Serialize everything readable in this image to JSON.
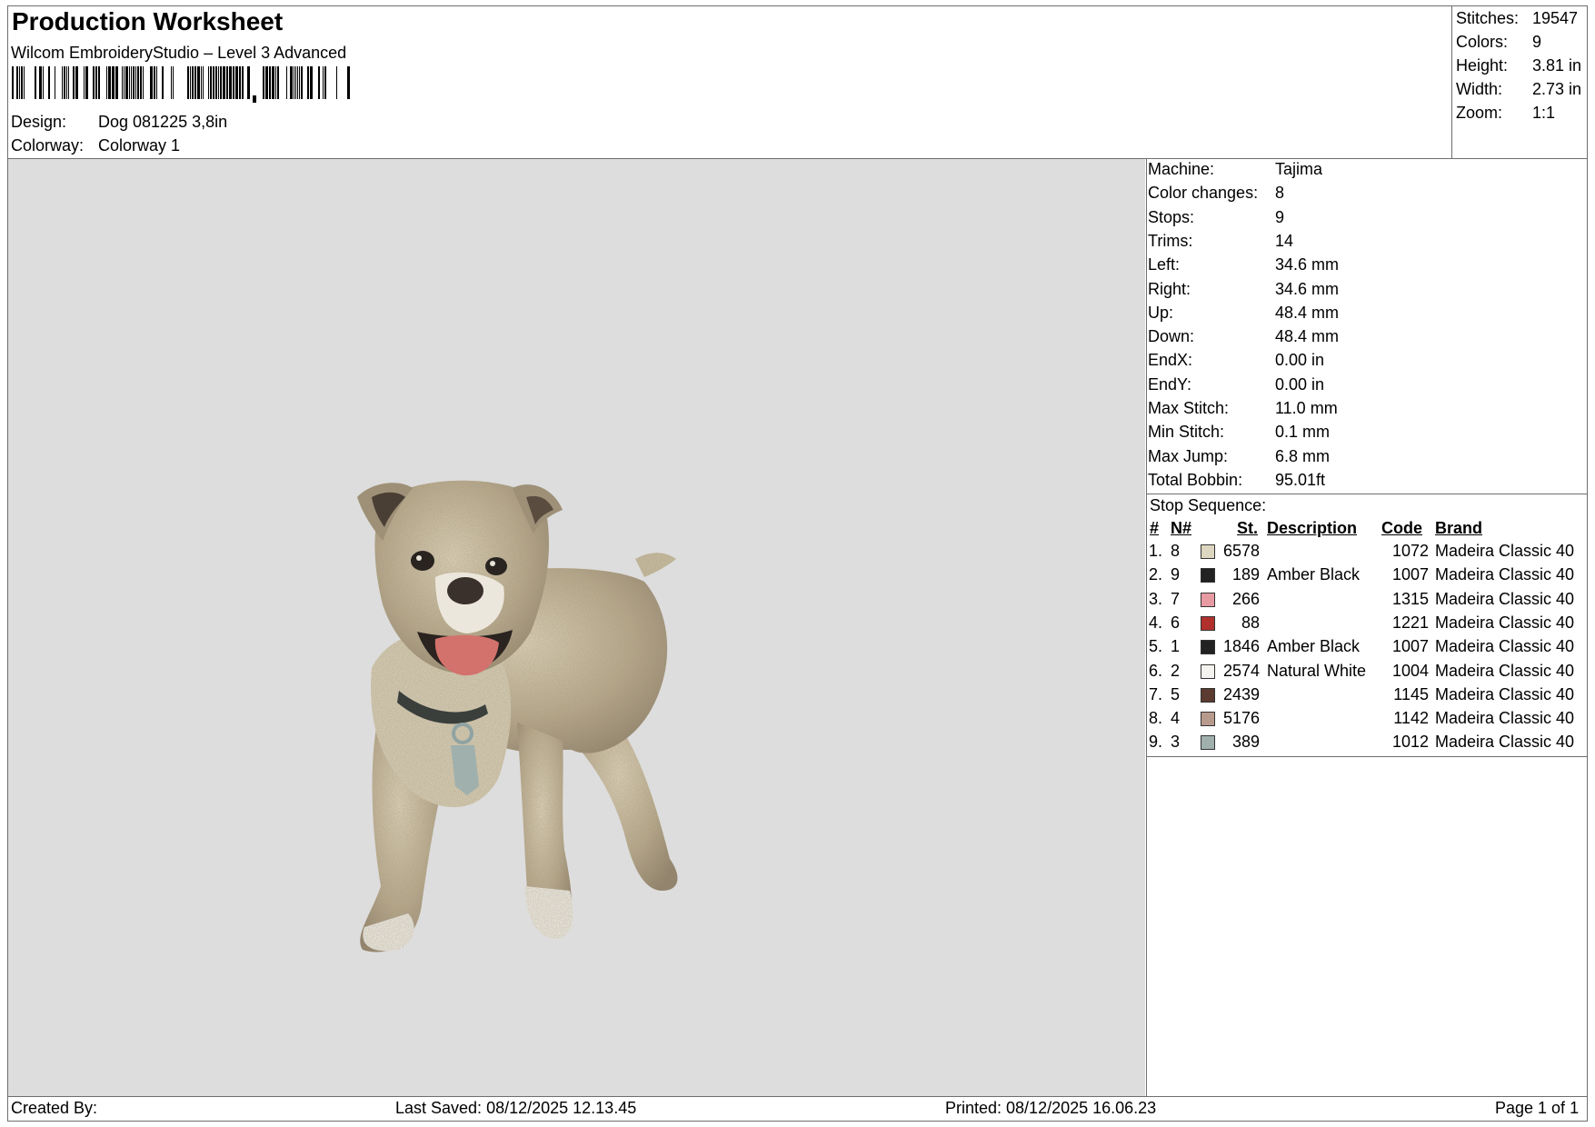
{
  "header": {
    "title": "Production Worksheet",
    "subtitle": "Wilcom EmbroideryStudio – Level 3 Advanced",
    "design_label": "Design:",
    "design_value": "Dog 081225 3,8in",
    "colorway_label": "Colorway:",
    "colorway_value": "Colorway 1"
  },
  "stats": [
    {
      "label": "Stitches:",
      "value": "19547"
    },
    {
      "label": "Colors:",
      "value": "9"
    },
    {
      "label": "Height:",
      "value": "3.81 in"
    },
    {
      "label": "Width:",
      "value": "2.73 in"
    },
    {
      "label": "Zoom:",
      "value": "1:1"
    }
  ],
  "machine_info": [
    {
      "label": "Machine:",
      "value": "Tajima"
    },
    {
      "label": "Color changes:",
      "value": "8"
    },
    {
      "label": "Stops:",
      "value": "9"
    },
    {
      "label": "Trims:",
      "value": "14"
    },
    {
      "label": "Left:",
      "value": "34.6 mm"
    },
    {
      "label": "Right:",
      "value": "34.6 mm"
    },
    {
      "label": "Up:",
      "value": "48.4 mm"
    },
    {
      "label": "Down:",
      "value": "48.4 mm"
    },
    {
      "label": "EndX:",
      "value": "0.00 in"
    },
    {
      "label": "EndY:",
      "value": "0.00 in"
    },
    {
      "label": "Max Stitch:",
      "value": "11.0 mm"
    },
    {
      "label": "Min Stitch:",
      "value": "0.1 mm"
    },
    {
      "label": "Max Jump:",
      "value": "6.8 mm"
    },
    {
      "label": "Total Bobbin:",
      "value": "95.01ft"
    }
  ],
  "stop_sequence": {
    "title": "Stop Sequence:",
    "headers": {
      "idx": "#",
      "n": "N#",
      "st": "St.",
      "desc": "Description",
      "code": "Code",
      "brand": "Brand"
    },
    "rows": [
      {
        "idx": "1.",
        "n": "8",
        "color": "#ddd6c0",
        "st": "6578",
        "desc": "",
        "code": "1072",
        "brand": "Madeira Classic 40"
      },
      {
        "idx": "2.",
        "n": "9",
        "color": "#222222",
        "st": "189",
        "desc": "Amber Black",
        "code": "1007",
        "brand": "Madeira Classic 40"
      },
      {
        "idx": "3.",
        "n": "7",
        "color": "#e89aa2",
        "st": "266",
        "desc": "",
        "code": "1315",
        "brand": "Madeira Classic 40"
      },
      {
        "idx": "4.",
        "n": "6",
        "color": "#b2302c",
        "st": "88",
        "desc": "",
        "code": "1221",
        "brand": "Madeira Classic 40"
      },
      {
        "idx": "5.",
        "n": "1",
        "color": "#222222",
        "st": "1846",
        "desc": "Amber Black",
        "code": "1007",
        "brand": "Madeira Classic 40"
      },
      {
        "idx": "6.",
        "n": "2",
        "color": "#f4f3ef",
        "st": "2574",
        "desc": "Natural White",
        "code": "1004",
        "brand": "Madeira Classic 40"
      },
      {
        "idx": "7.",
        "n": "5",
        "color": "#5b3a30",
        "st": "2439",
        "desc": "",
        "code": "1145",
        "brand": "Madeira Classic 40"
      },
      {
        "idx": "8.",
        "n": "4",
        "color": "#b89a8c",
        "st": "5176",
        "desc": "",
        "code": "1142",
        "brand": "Madeira Classic 40"
      },
      {
        "idx": "9.",
        "n": "3",
        "color": "#9fb0ad",
        "st": "389",
        "desc": "",
        "code": "1012",
        "brand": "Madeira Classic 40"
      }
    ]
  },
  "footer": {
    "created": "Created By:",
    "saved": "Last Saved: 08/12/2025 12.13.45",
    "printed": "Printed: 08/12/2025 16.06.23",
    "page": "Page 1 of 1"
  },
  "colors": {
    "canvas_bg": "#dddddd",
    "dog_fur": "#a8987a",
    "dog_fur_light": "#ddd3bb"
  }
}
